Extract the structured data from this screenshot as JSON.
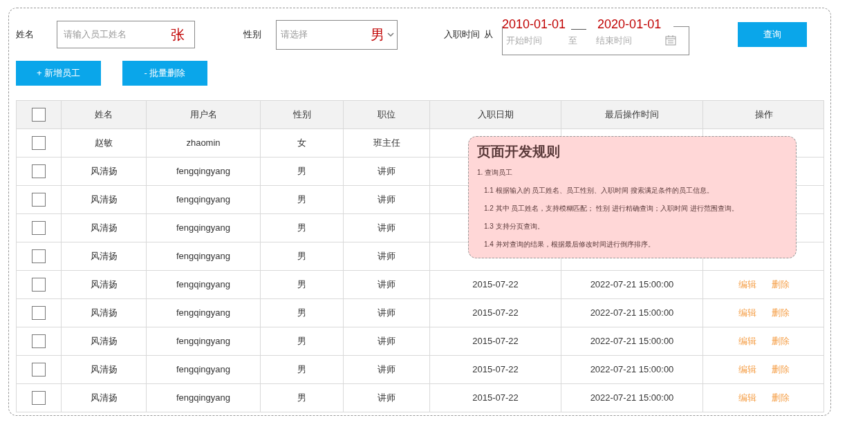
{
  "filters": {
    "name": {
      "label": "姓名",
      "placeholder": "请输入员工姓名",
      "annotation": "张"
    },
    "gender": {
      "label": "性别",
      "placeholder": "请选择",
      "annotation": "男"
    },
    "hire_date": {
      "label": "入职时间",
      "from": "从",
      "start_placeholder": "开始时间",
      "separator": "至",
      "end_placeholder": "结束时间",
      "start_annotation": "2010-01-01",
      "end_annotation": "2020-01-01"
    },
    "search_button": "查询"
  },
  "actions": [
    "+ 新增员工",
    "- 批量删除"
  ],
  "table": {
    "select_all": {
      "checked": false
    },
    "columns": [
      "姓名",
      "用户名",
      "性别",
      "职位",
      "入职日期",
      "最后操作时间",
      "操作"
    ],
    "rows": [
      {
        "checked": false,
        "name": "赵敏",
        "username": "zhaomin",
        "gender": "女",
        "position": "班主任"
      },
      {
        "checked": false,
        "name": "风清扬",
        "username": "fengqingyang",
        "gender": "男",
        "position": "讲师"
      },
      {
        "checked": false,
        "name": "风清扬",
        "username": "fengqingyang",
        "gender": "男",
        "position": "讲师"
      },
      {
        "checked": false,
        "name": "风清扬",
        "username": "fengqingyang",
        "gender": "男",
        "position": "讲师"
      },
      {
        "checked": false,
        "name": "风清扬",
        "username": "fengqingyang",
        "gender": "男",
        "position": "讲师"
      },
      {
        "checked": false,
        "name": "风清扬",
        "username": "fengqingyang",
        "gender": "男",
        "position": "讲师",
        "hire_date": "2015-07-22",
        "last_modified": "2022-07-21 15:00:00",
        "edit": "编辑",
        "delete": "删除"
      },
      {
        "checked": false,
        "name": "风清扬",
        "username": "fengqingyang",
        "gender": "男",
        "position": "讲师",
        "hire_date": "2015-07-22",
        "last_modified": "2022-07-21 15:00:00",
        "edit": "编辑",
        "delete": "删除"
      },
      {
        "checked": false,
        "name": "风清扬",
        "username": "fengqingyang",
        "gender": "男",
        "position": "讲师",
        "hire_date": "2015-07-22",
        "last_modified": "2022-07-21 15:00:00",
        "edit": "编辑",
        "delete": "删除"
      },
      {
        "checked": false,
        "name": "风清扬",
        "username": "fengqingyang",
        "gender": "男",
        "position": "讲师",
        "hire_date": "2015-07-22",
        "last_modified": "2022-07-21 15:00:00",
        "edit": "编辑",
        "delete": "删除"
      },
      {
        "checked": false,
        "name": "风清扬",
        "username": "fengqingyang",
        "gender": "男",
        "position": "讲师",
        "hire_date": "2015-07-22",
        "last_modified": "2022-07-21 15:00:00",
        "edit": "编辑",
        "delete": "删除"
      }
    ]
  },
  "note": {
    "title": "页面开发规则",
    "lines": [
      {
        "kind": "heading",
        "text": "1. 查询员工"
      },
      {
        "kind": "item",
        "text": "1.1 根据输入的 员工姓名、员工性别、入职时间 搜索满足条件的员工信息。"
      },
      {
        "kind": "item",
        "text": "1.2 其中 员工姓名，支持模糊匹配； 性别 进行精确查询；入职时间 进行范围查询。"
      },
      {
        "kind": "item",
        "text": "1.3 支持分页查询。"
      },
      {
        "kind": "item",
        "text": "1.4 并对查询的结果，根据最后修改时间进行倒序排序。"
      }
    ]
  }
}
